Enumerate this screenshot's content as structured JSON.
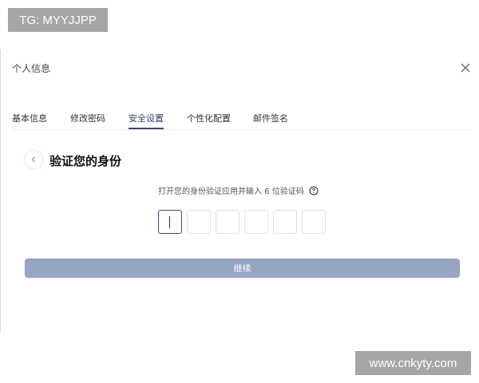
{
  "watermarks": {
    "top": "TG: MYYJJPP",
    "bottom": "www.cnkyty.com"
  },
  "dialog": {
    "title": "个人信息",
    "close_icon": "close-icon"
  },
  "tabs": [
    {
      "label": "基本信息",
      "active": false
    },
    {
      "label": "修改密码",
      "active": false
    },
    {
      "label": "安全设置",
      "active": true
    },
    {
      "label": "个性化配置",
      "active": false
    },
    {
      "label": "邮件签名",
      "active": false
    }
  ],
  "verify": {
    "back_icon": "chevron-left-icon",
    "title": "验证您的身份",
    "instruction": "打开您的身份验证应用并输入 6 位验证码",
    "help_icon": "question-circle-icon",
    "code_length": 6,
    "code_values": [
      "",
      "",
      "",
      "",
      "",
      ""
    ]
  },
  "actions": {
    "continue_label": "继续"
  },
  "colors": {
    "accent": "#3a4a78",
    "button_bg": "#97a5c4"
  }
}
